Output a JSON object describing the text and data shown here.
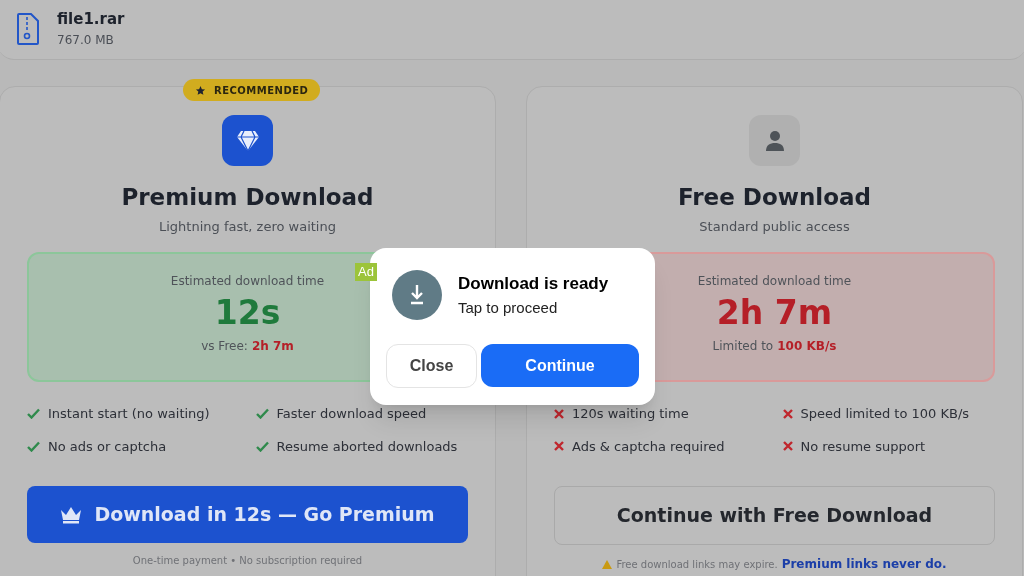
{
  "file": {
    "name": "file1.rar",
    "size": "767.0 MB"
  },
  "plans": [
    {
      "kind": "premium",
      "badge": "RECOMMENDED",
      "title": "Premium Download",
      "subtitle": "Lightning fast, zero waiting",
      "estimate": {
        "label": "Estimated download time",
        "value": "12s",
        "note": "vs Free:",
        "note_value": "2h 7m"
      },
      "features": [
        {
          "text": "Instant start (no waiting)",
          "included": true
        },
        {
          "text": "Faster download speed",
          "included": true
        },
        {
          "text": "No ads or captcha",
          "included": true
        },
        {
          "text": "Resume aborted downloads",
          "included": true
        }
      ],
      "button": "Download in 12s — Go Premium",
      "footnote": "One-time payment • No subscription required"
    },
    {
      "kind": "free",
      "title": "Free Download",
      "subtitle": "Standard public access",
      "estimate": {
        "label": "Estimated download time",
        "value": "2h 7m",
        "note": "Limited to",
        "note_value": "100 KB/s"
      },
      "features": [
        {
          "text": "120s waiting time",
          "included": false
        },
        {
          "text": "Speed limited to 100 KB/s",
          "included": false
        },
        {
          "text": "Ads & captcha required",
          "included": false
        },
        {
          "text": "No resume support",
          "included": false
        }
      ],
      "button": "Continue with Free Download",
      "footnote": "Free download links may expire.",
      "footnote_link": "Premium links never do."
    }
  ],
  "popup": {
    "ad_label": "Ad",
    "title": "Download is ready",
    "subtitle": "Tap to proceed",
    "buttons": [
      {
        "label": "Close",
        "kind": "secondary"
      },
      {
        "label": "Continue",
        "kind": "primary"
      }
    ]
  }
}
